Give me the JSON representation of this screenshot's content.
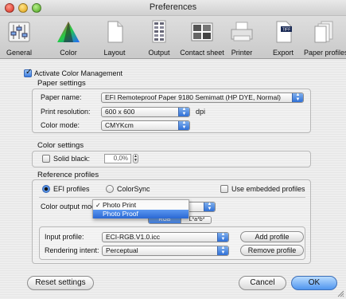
{
  "window": {
    "title": "Preferences"
  },
  "toolbar": {
    "items": [
      {
        "label": "General",
        "icon": "sliders-icon"
      },
      {
        "label": "Color",
        "icon": "color-triangle-icon"
      },
      {
        "label": "Layout",
        "icon": "page-icon"
      },
      {
        "label": "Output",
        "icon": "page-grid-icon"
      },
      {
        "label": "Contact sheet",
        "icon": "contact-sheet-icon"
      },
      {
        "label": "Printer",
        "icon": "printer-icon"
      },
      {
        "label": "Export",
        "icon": "export-tiff-icon"
      },
      {
        "label": "Paper profiles",
        "icon": "paper-profiles-icon"
      }
    ],
    "export_badge": "TIFF"
  },
  "color_management": {
    "label": "Activate Color Management",
    "checked": true
  },
  "paper_settings": {
    "title": "Paper settings",
    "paper_name_label": "Paper name:",
    "paper_name_value": "EFI Remoteproof Paper 9180 Semimatt (HP DYE, Normal)",
    "resolution_label": "Print resolution:",
    "resolution_value": "600 x 600",
    "resolution_unit": "dpi",
    "color_mode_label": "Color mode:",
    "color_mode_value": "CMYKcm"
  },
  "color_settings": {
    "title": "Color settings",
    "solid_black_label": "Solid black:",
    "solid_black_value": "0,0%"
  },
  "reference_profiles": {
    "title": "Reference profiles",
    "efi_label": "EFI profiles",
    "colorsync_label": "ColorSync",
    "embedded_label": "Use embedded profiles",
    "output_mode_label": "Color output mode:",
    "output_menu": {
      "items": [
        {
          "label": "Photo Print",
          "checked": true
        },
        {
          "label": "Photo Proof",
          "selected": true
        }
      ]
    },
    "segments": [
      "RGB",
      "L*a*b*"
    ],
    "input_profile_label": "Input profile:",
    "input_profile_value": "ECI-RGB.V1.0.icc",
    "rendering_intent_label": "Rendering intent:",
    "rendering_intent_value": "Perceptual",
    "add_profile": "Add profile",
    "remove_profile": "Remove profile"
  },
  "footer": {
    "reset": "Reset settings",
    "cancel": "Cancel",
    "ok": "OK"
  },
  "colors": {
    "accent": "#2f6fd6",
    "menu_highlight": "#3a78de"
  }
}
